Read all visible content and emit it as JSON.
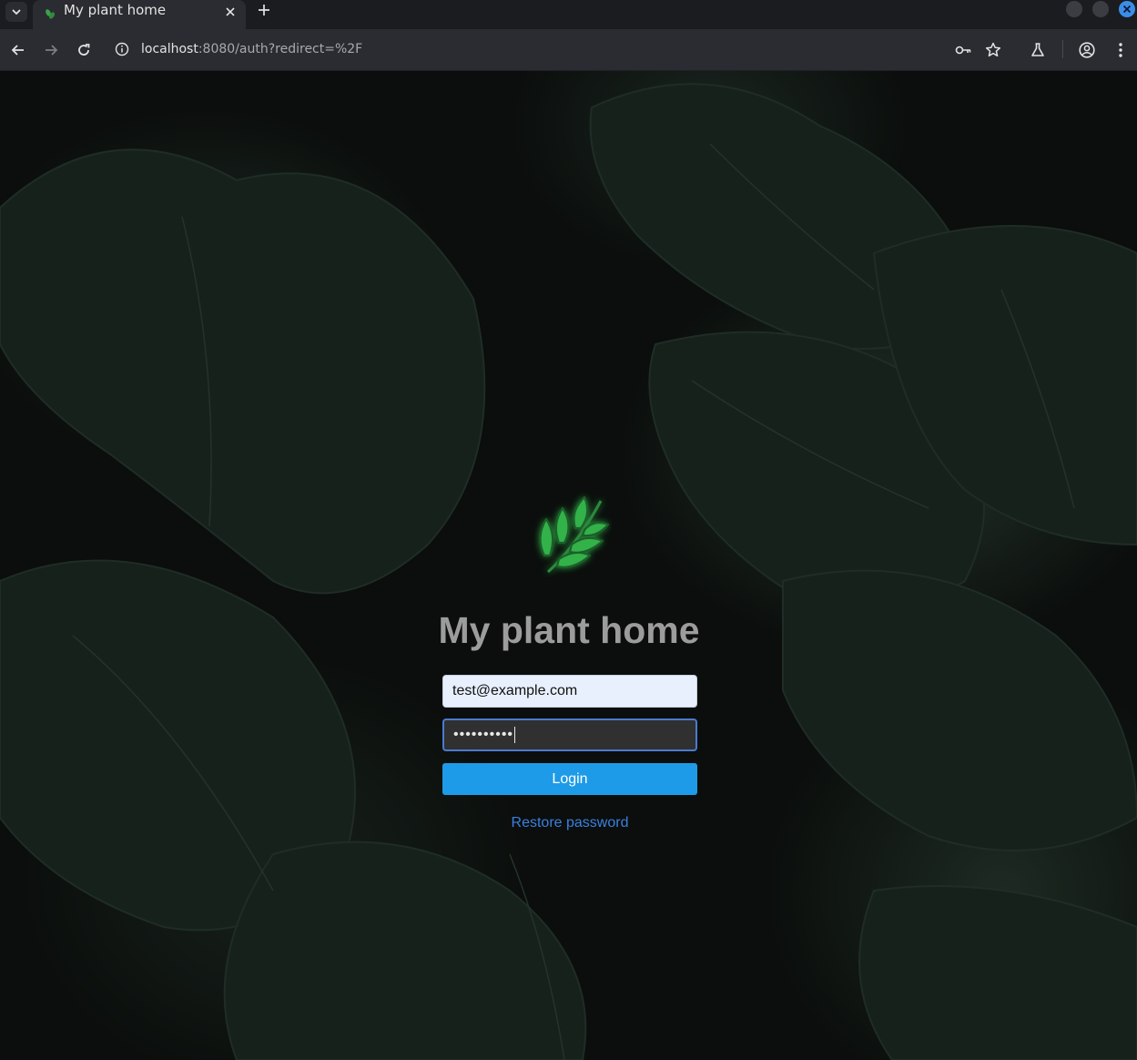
{
  "browser": {
    "tab_title": "My plant home",
    "url_host": "localhost",
    "url_rest": ":8080/auth?redirect=%2F",
    "accent": "#3b8ee8"
  },
  "page": {
    "app_title": "My plant home",
    "email_value": "test@example.com",
    "password_value": "••••••••••",
    "login_label": "Login",
    "restore_label": "Restore password",
    "button_color": "#1e9be8",
    "link_color": "#3a80e0",
    "logo_icon": "leaf-branch-icon"
  }
}
